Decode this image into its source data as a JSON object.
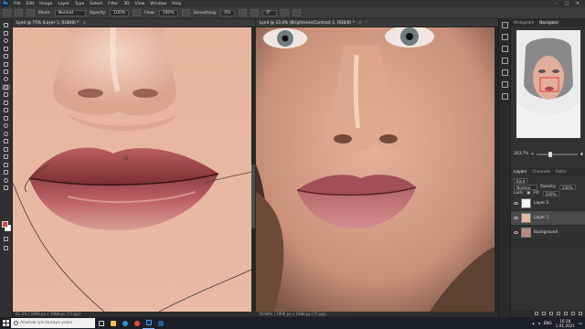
{
  "menubar": {
    "items": [
      "File",
      "Edit",
      "Image",
      "Layer",
      "Type",
      "Select",
      "Filter",
      "3D",
      "View",
      "Window",
      "Help"
    ],
    "app_icon": "Ps"
  },
  "options": {
    "mode_label": "Mode:",
    "mode_value": "Normal",
    "opacity_label": "Opacity:",
    "opacity_value": "100%",
    "flow_label": "Flow:",
    "flow_value": "100%",
    "smoothing_label": "Smoothing:",
    "smoothing_value": "0%",
    "angle_value": "0°"
  },
  "doc_left": {
    "tab": "Lyed @ 75% (Layer 1, RGB/8) *",
    "status": "61.3% | 1990 px x 1988 px (72 ppi)"
  },
  "doc_right": {
    "tab": "Lyed @ 33.4% (Brightness/Contrast 1, RGB/8) *",
    "status": "78.64% | 1990 px x 1988 px (72 ppi)"
  },
  "panels": {
    "top_tabs": [
      "Histogram",
      "Navigator"
    ],
    "zoom": "203.7%",
    "layer_tabs": [
      "Layers",
      "Channels",
      "Paths"
    ],
    "kind_label": "Kind",
    "blend": "Normal",
    "opacity_label": "Opacity:",
    "opacity": "100%",
    "lock_label": "Lock:",
    "fill_label": "Fill:",
    "fill": "100%",
    "layers": [
      {
        "name": "Layer 2",
        "selected": false
      },
      {
        "name": "Layer 1",
        "selected": true
      },
      {
        "name": "Background",
        "selected": false
      }
    ]
  },
  "taskbar": {
    "search_placeholder": "Aramak için buraya yazın",
    "lang": "ENG",
    "time": "16:18",
    "date": "1.01.2021"
  },
  "colors": {
    "foreground": "#c94a4a",
    "background": "#ffffff",
    "accent": "#31a8ff"
  }
}
